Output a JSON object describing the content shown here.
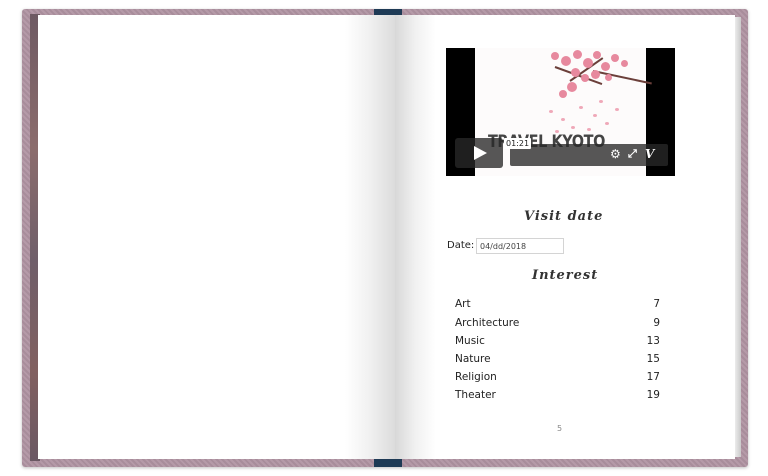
{
  "video": {
    "title": "TRAVEL KYOTO",
    "timestamp": "01:21",
    "play_icon": "play-icon",
    "settings_icon": "gear-icon",
    "fullscreen_icon": "fullscreen-icon",
    "brand_icon": "vimeo-icon",
    "brand_glyph": "V"
  },
  "visit": {
    "heading": "Visit date",
    "date_label": "Date:",
    "date_value": "04/dd/2018"
  },
  "interest": {
    "heading": "Interest",
    "items": [
      {
        "label": "Art",
        "count": "7"
      },
      {
        "label": "Architecture",
        "count": "9"
      },
      {
        "label": "Music",
        "count": "13"
      },
      {
        "label": "Nature",
        "count": "15"
      },
      {
        "label": "Religion",
        "count": "17"
      },
      {
        "label": "Theater",
        "count": "19"
      }
    ]
  },
  "page_number": "5",
  "colors": {
    "cover": "#b59aa8",
    "ribbon": "#1e3a55",
    "blossom": "#e7899e"
  }
}
